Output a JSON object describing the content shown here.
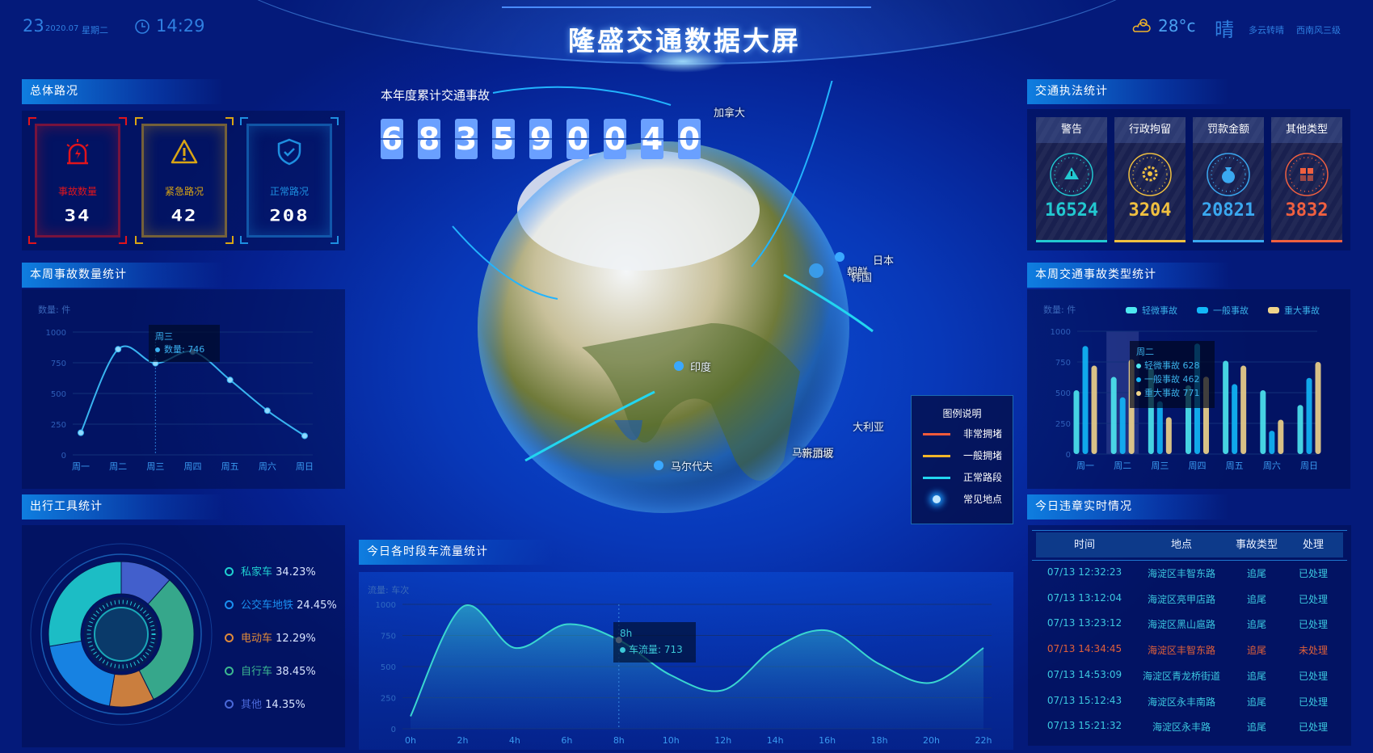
{
  "header": {
    "day": "23",
    "year_month": "2020.07",
    "weekday": "星期二",
    "time": "14:29",
    "title": "隆盛交通数据大屏",
    "temperature": "28°c",
    "weather": "晴",
    "forecast": "多云转晴",
    "wind": "西南风三级",
    "icons": [
      "clock-icon",
      "sun-cloud-icon"
    ]
  },
  "overview": {
    "title": "总体路况",
    "cards": [
      {
        "label": "事故数量",
        "value": "34",
        "color": "#e0141c",
        "icon": "alarm-light-icon"
      },
      {
        "label": "紧急路况",
        "value": "42",
        "color": "#d9a514",
        "icon": "warning-icon"
      },
      {
        "label": "正常路况",
        "value": "208",
        "color": "#1e8fe0",
        "icon": "shield-check-icon"
      }
    ]
  },
  "weekly_accidents": {
    "title": "本周事故数量统计",
    "unit": "数量: 件",
    "tooltip": {
      "day": "周三",
      "label": "数量: ",
      "value": "746"
    }
  },
  "travel": {
    "title": "出行工具统计",
    "items": [
      {
        "label": "私家车",
        "value": "34.23%",
        "color": "#1fd0d0"
      },
      {
        "label": "公交车地铁",
        "value": "24.45%",
        "color": "#1a8ff0"
      },
      {
        "label": "电动车",
        "value": "12.29%",
        "color": "#e08a3a"
      },
      {
        "label": "自行车",
        "value": "38.45%",
        "color": "#3cb890"
      },
      {
        "label": "其他",
        "value": "14.35%",
        "color": "#4a68d8"
      }
    ]
  },
  "annual": {
    "title": "本年度累计交通事故",
    "digits": [
      "6",
      "8",
      "3",
      "5",
      "9",
      "0",
      "0",
      "4",
      "0"
    ]
  },
  "globe": {
    "labels": [
      "加拿大",
      "日本",
      "朝鲜",
      "韩国",
      "印度",
      "大利亚",
      "马来西亚",
      "新加坡",
      "马尔代夫"
    ]
  },
  "map_legend": {
    "title": "图例说明",
    "items": [
      {
        "label": "非常拥堵",
        "color": "#f05a3a"
      },
      {
        "label": "一般拥堵",
        "color": "#f2b52a"
      },
      {
        "label": "正常路段",
        "color": "#22d6f0"
      },
      {
        "label": "常见地点",
        "color": "#bfe6ff"
      }
    ]
  },
  "traffic_flow": {
    "title": "今日各时段车流量统计",
    "unit": "流量: 车次",
    "tooltip": {
      "hour": "8h",
      "label": "车流量: ",
      "value": "713"
    }
  },
  "enforcement": {
    "title": "交通执法统计",
    "cards": [
      {
        "label": "警告",
        "value": "16524",
        "color": "#22c8d0",
        "icon": "warning-triangle-icon"
      },
      {
        "label": "行政拘留",
        "value": "3204",
        "color": "#f0c040",
        "icon": "gear-people-icon"
      },
      {
        "label": "罚款金额",
        "value": "20821",
        "color": "#3aa8f0",
        "icon": "money-bag-icon"
      },
      {
        "label": "其他类型",
        "value": "3832",
        "color": "#f06040",
        "icon": "grid-boxes-icon"
      }
    ]
  },
  "accident_types": {
    "title": "本周交通事故类型统计",
    "unit": "数量: 件",
    "tooltip": {
      "day": "周二",
      "rows": [
        {
          "label": "轻微事故",
          "value": "628"
        },
        {
          "label": "一般事故",
          "value": "462"
        },
        {
          "label": "重大事故",
          "value": "771"
        }
      ]
    }
  },
  "violations": {
    "title": "今日违章实时情况",
    "columns": [
      "时间",
      "地点",
      "事故类型",
      "处理"
    ],
    "rows": [
      {
        "time": "07/13 12:32:23",
        "place": "海淀区丰智东路",
        "type": "追尾",
        "status": "已处理",
        "alert": false
      },
      {
        "time": "07/13 13:12:04",
        "place": "海淀区亮甲店路",
        "type": "追尾",
        "status": "已处理",
        "alert": false
      },
      {
        "time": "07/13 13:23:12",
        "place": "海淀区黑山扈路",
        "type": "追尾",
        "status": "已处理",
        "alert": false
      },
      {
        "time": "07/13 14:34:45",
        "place": "海淀区丰智东路",
        "type": "追尾",
        "status": "未处理",
        "alert": true
      },
      {
        "time": "07/13 14:53:09",
        "place": "海淀区青龙桥街道",
        "type": "追尾",
        "status": "已处理",
        "alert": false
      },
      {
        "time": "07/13 15:12:43",
        "place": "海淀区永丰南路",
        "type": "追尾",
        "status": "已处理",
        "alert": false
      },
      {
        "time": "07/13 15:21:32",
        "place": "海淀区永丰路",
        "type": "追尾",
        "status": "已处理",
        "alert": false
      }
    ]
  },
  "chart_data": [
    {
      "type": "line",
      "title": "本周事故数量统计",
      "ylabel": "数量: 件",
      "categories": [
        "周一",
        "周二",
        "周三",
        "周四",
        "周五",
        "周六",
        "周日"
      ],
      "values": [
        180,
        860,
        746,
        840,
        610,
        360,
        155
      ],
      "ylim": [
        0,
        1000
      ],
      "yticks": [
        0,
        250,
        500,
        750,
        1000
      ],
      "grid": true,
      "color": "#39b4f0"
    },
    {
      "type": "bar",
      "title": "本周交通事故类型统计",
      "ylabel": "数量: 件",
      "categories": [
        "周一",
        "周二",
        "周三",
        "周四",
        "周五",
        "周六",
        "周日"
      ],
      "ylim": [
        0,
        1000
      ],
      "yticks": [
        0,
        250,
        500,
        750,
        1000
      ],
      "grid": true,
      "legend": "top-right",
      "series": [
        {
          "name": "轻微事故",
          "color": "#4ee8f0",
          "values": [
            520,
            628,
            700,
            560,
            760,
            520,
            400
          ]
        },
        {
          "name": "一般事故",
          "color": "#12b8f8",
          "values": [
            880,
            462,
            430,
            900,
            570,
            190,
            620
          ]
        },
        {
          "name": "重大事故",
          "color": "#f0d48a",
          "values": [
            720,
            771,
            300,
            630,
            720,
            280,
            750
          ]
        }
      ]
    },
    {
      "type": "area",
      "title": "今日各时段车流量统计",
      "ylabel": "流量: 车次",
      "categories": [
        "0h",
        "2h",
        "4h",
        "6h",
        "8h",
        "10h",
        "12h",
        "14h",
        "16h",
        "18h",
        "20h",
        "22h"
      ],
      "values": [
        100,
        980,
        650,
        840,
        713,
        430,
        310,
        650,
        790,
        520,
        370,
        650
      ],
      "ylim": [
        0,
        1000
      ],
      "yticks": [
        0,
        250,
        500,
        750,
        1000
      ],
      "grid": true,
      "color": "#3ad6d0"
    },
    {
      "type": "pie",
      "title": "出行工具统计",
      "categories": [
        "私家车",
        "公交车地铁",
        "电动车",
        "自行车",
        "其他"
      ],
      "values": [
        34.23,
        24.45,
        12.29,
        38.45,
        14.35
      ]
    }
  ]
}
